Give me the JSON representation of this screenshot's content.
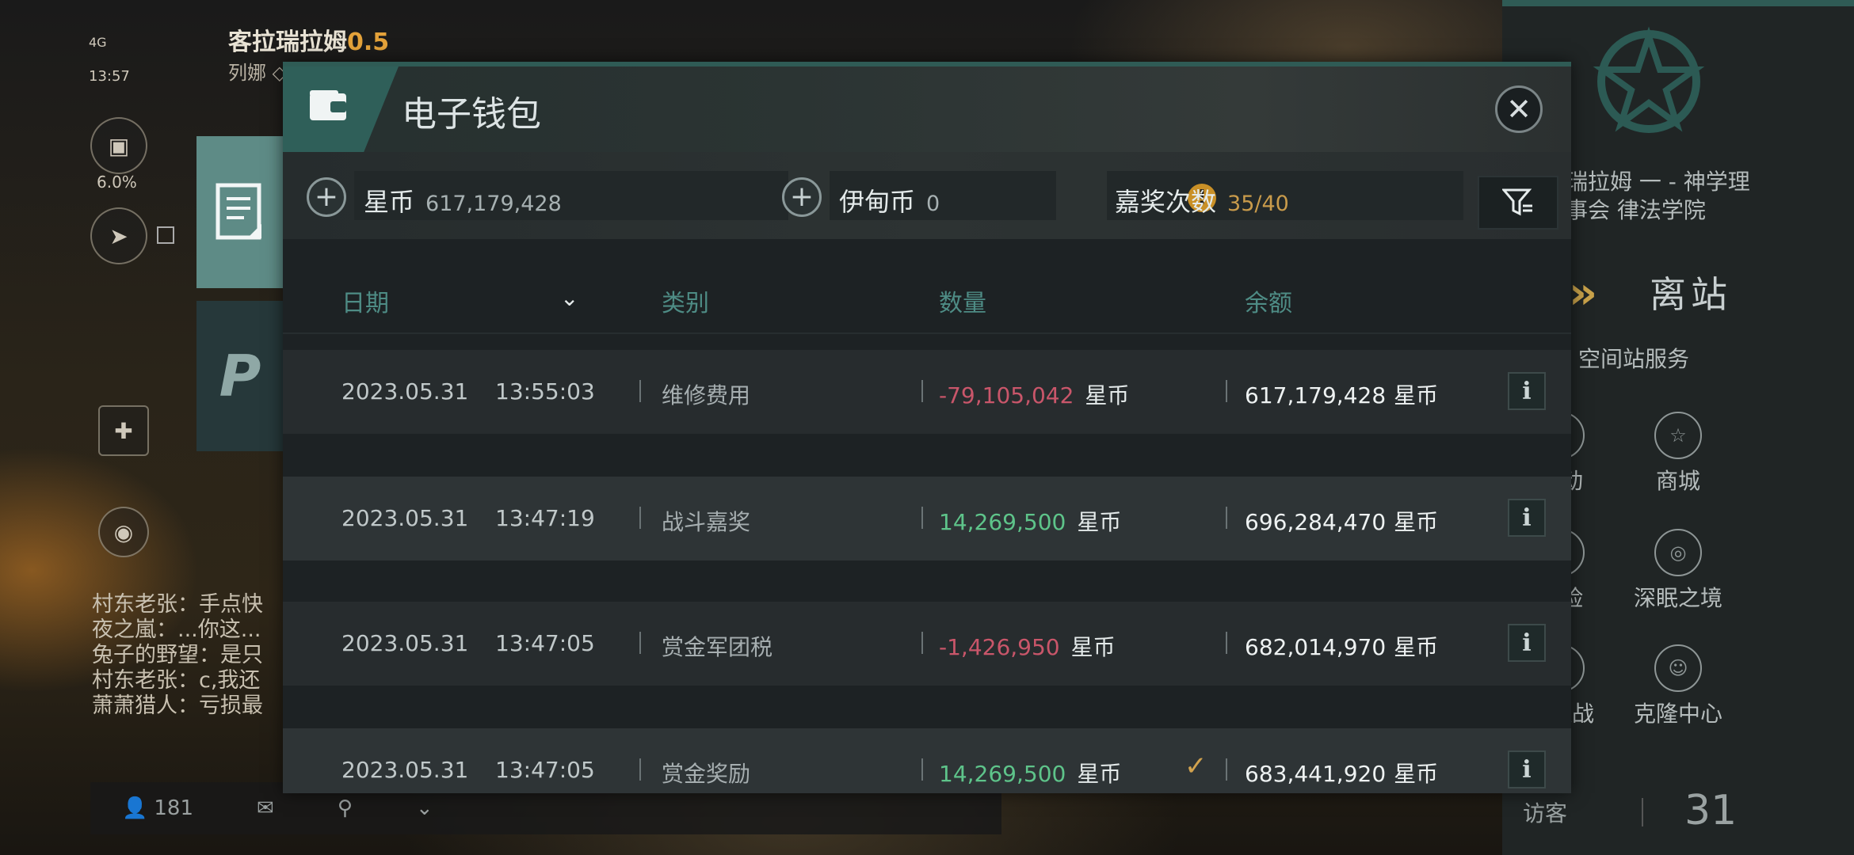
{
  "hud": {
    "player_name": "客拉瑞拉姆",
    "security": "0.5",
    "player_sub": "列娜 ◇",
    "signal": "4G",
    "clock": "13:57",
    "percent": "6.0%",
    "chat_lines": [
      "村东老张：手点快",
      "夜之嵐：...你这...",
      "兔子的野望：是只",
      "村东老张：c,我还",
      "萧萧猎人：亏损最"
    ],
    "bottom_count": "181"
  },
  "station": {
    "line1": "瑞拉姆 一 - 神学理",
    "line2": "事会 律法学院",
    "undock_label": "离站",
    "services_title": "空间站服务",
    "services": [
      {
        "label": "活动",
        "icon": "activity-icon"
      },
      {
        "label": "商城",
        "icon": "shop-icon"
      },
      {
        "label": "保险",
        "icon": "insurance-icon"
      },
      {
        "label": "深眠之境",
        "icon": "deep-sleep-icon"
      },
      {
        "label": "模拟战",
        "icon": "simulation-icon"
      },
      {
        "label": "克隆中心",
        "icon": "clone-center-icon"
      }
    ],
    "visitors_label": "访客",
    "visitors_count": "31"
  },
  "wallet": {
    "title": "电子钱包",
    "close_glyph": "✕",
    "currencies": [
      {
        "label": "星币",
        "value": "617,179,428"
      },
      {
        "label": "伊甸币",
        "value": "0"
      }
    ],
    "bonus": {
      "label": "嘉奖次数",
      "value": "35/40"
    },
    "columns": {
      "date": "日期",
      "category": "类别",
      "amount": "数量",
      "balance": "余额"
    },
    "rows": [
      {
        "date": "2023.05.31",
        "time": "13:55:03",
        "category": "维修费用",
        "amount": "-79,105,042",
        "amount_sign": "negative",
        "unit": "星币",
        "balance": "617,179,428",
        "checked": false
      },
      {
        "date": "2023.05.31",
        "time": "13:47:19",
        "category": "战斗嘉奖",
        "amount": "14,269,500",
        "amount_sign": "positive",
        "unit": "星币",
        "balance": "696,284,470",
        "checked": false
      },
      {
        "date": "2023.05.31",
        "time": "13:47:05",
        "category": "赏金军团税",
        "amount": "-1,426,950",
        "amount_sign": "negative",
        "unit": "星币",
        "balance": "682,014,970",
        "checked": false
      },
      {
        "date": "2023.05.31",
        "time": "13:47:05",
        "category": "赏金奖励",
        "amount": "14,269,500",
        "amount_sign": "positive",
        "unit": "星币",
        "balance": "683,441,920",
        "checked": true
      }
    ]
  },
  "colors": {
    "accent_teal": "#2f5f59",
    "negative": "#c9566a",
    "positive": "#5ec48a",
    "gold": "#c99027"
  }
}
